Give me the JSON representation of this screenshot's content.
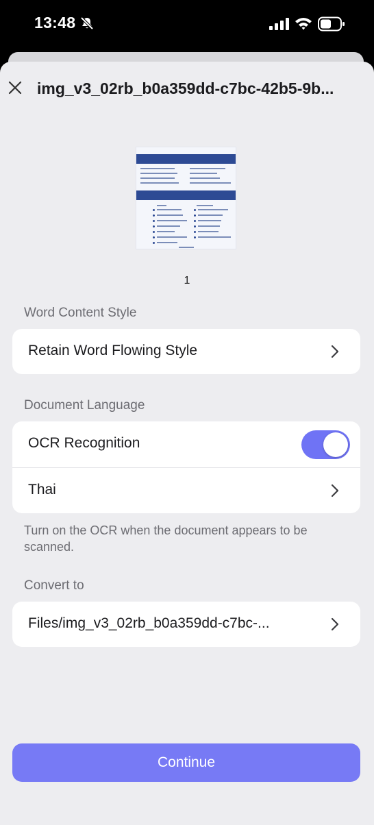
{
  "status_bar": {
    "time": "13:48",
    "icons": [
      "bell-slash-icon",
      "cellular-signal-icon",
      "wifi-icon",
      "battery-icon"
    ]
  },
  "header": {
    "title": "img_v3_02rb_b0a359dd-c7bc-42b5-9b...",
    "close_icon": "close-icon"
  },
  "preview": {
    "page_number": "1"
  },
  "word_content_style": {
    "label": "Word Content Style",
    "value": "Retain Word Flowing Style"
  },
  "document_language": {
    "label": "Document Language",
    "ocr_label": "OCR Recognition",
    "ocr_enabled": true,
    "language": "Thai",
    "hint": "Turn on the OCR when the document appears to be scanned."
  },
  "convert_to": {
    "label": "Convert to",
    "path": "Files/img_v3_02rb_b0a359dd-c7bc-..."
  },
  "continue_label": "Continue",
  "colors": {
    "accent": "#6f73f5",
    "button": "#777af5",
    "sheet_background": "#ededf0",
    "card": "#ffffff",
    "secondary_text": "#6c6c72"
  }
}
